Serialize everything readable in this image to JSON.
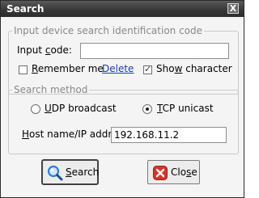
{
  "window": {
    "title": "Search",
    "close_glyph": "X"
  },
  "identification": {
    "legend": "Input device search identification code",
    "input_code_label": "Input code:",
    "input_code_value": "",
    "remember_me_label": "Remember me",
    "remember_me_checked": false,
    "delete_link": "Delete",
    "show_character_label": "Show character",
    "show_character_checked": true
  },
  "method": {
    "legend": "Search method",
    "udp_label": "UDP broadcast",
    "udp_selected": false,
    "tcp_label": "TCP unicast",
    "tcp_selected": true,
    "host_label": "Host name/IP addr:",
    "host_value": "192.168.11.2"
  },
  "buttons": {
    "search_label": "Search",
    "search_icon": "magnifier-icon",
    "close_label": "Close",
    "close_icon": "red-x-icon"
  },
  "colors": {
    "title_bar": "#383838",
    "link": "#1a3cb0",
    "close_icon_red": "#d9342b",
    "search_icon_blue": "#2f7fd8"
  }
}
